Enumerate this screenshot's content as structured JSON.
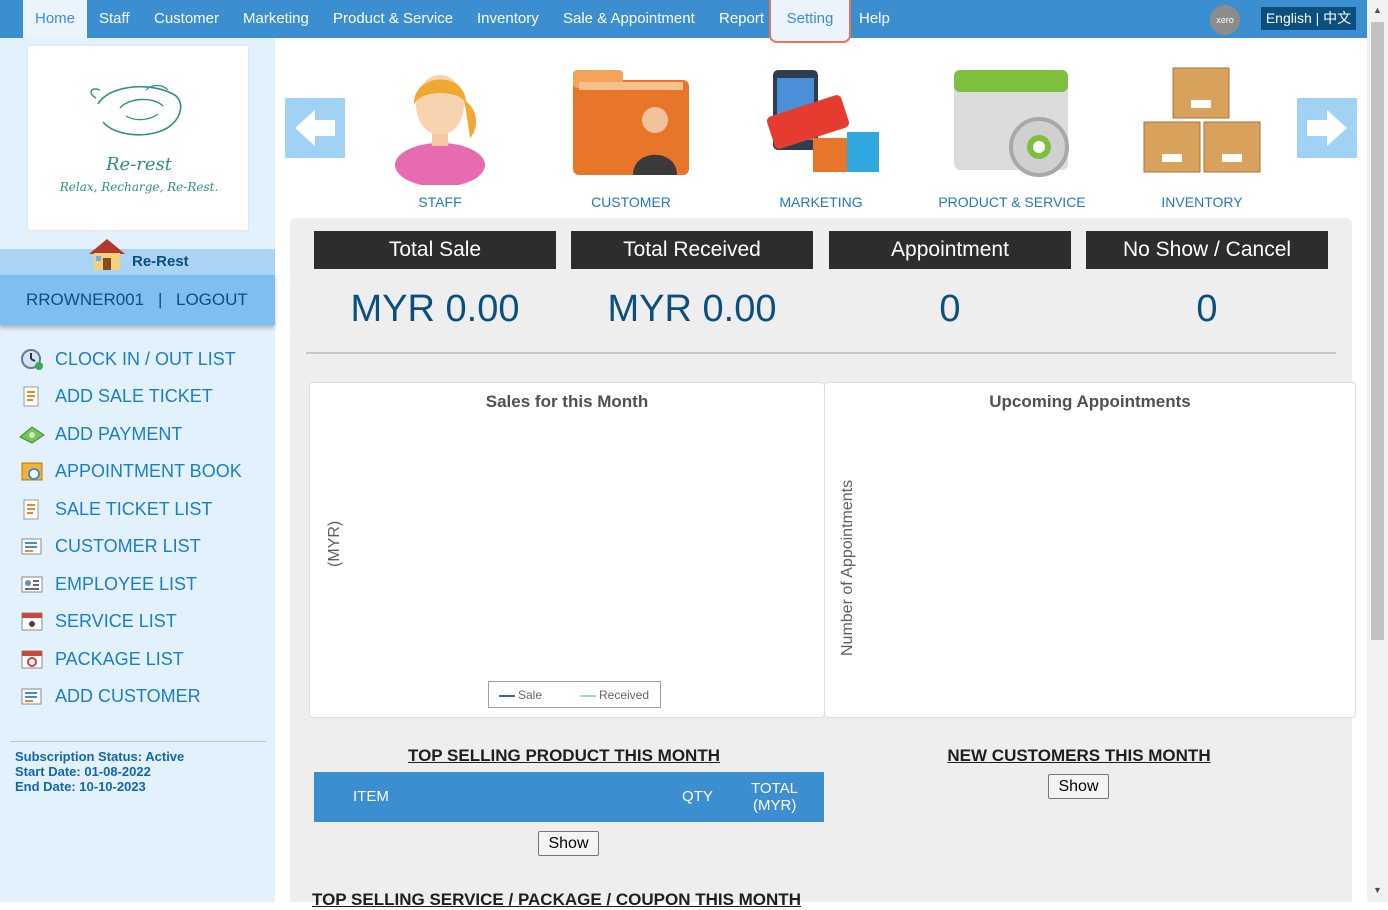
{
  "nav": {
    "items": [
      "Home",
      "Staff",
      "Customer",
      "Marketing",
      "Product & Service",
      "Inventory",
      "Sale & Appointment",
      "Report",
      "Setting",
      "Help"
    ],
    "xero": "xero",
    "language": "English | 中文"
  },
  "sidebar": {
    "logo_title": "Re-rest",
    "logo_tagline": "Relax, Recharge, Re-Rest.",
    "shop_name": "Re-Rest",
    "username": "RROWNER001",
    "separator": "|",
    "logout": "LOGOUT",
    "menu": [
      {
        "label": "CLOCK IN / OUT LIST",
        "icon": "clock-icon"
      },
      {
        "label": "ADD SALE TICKET",
        "icon": "sale-ticket-icon"
      },
      {
        "label": "ADD PAYMENT",
        "icon": "money-icon"
      },
      {
        "label": "APPOINTMENT BOOK",
        "icon": "appointment-book-icon"
      },
      {
        "label": "SALE TICKET LIST",
        "icon": "sale-ticket-list-icon"
      },
      {
        "label": "CUSTOMER LIST",
        "icon": "customer-list-icon"
      },
      {
        "label": "EMPLOYEE LIST",
        "icon": "employee-list-icon"
      },
      {
        "label": "SERVICE LIST",
        "icon": "service-list-icon"
      },
      {
        "label": "PACKAGE LIST",
        "icon": "package-list-icon"
      },
      {
        "label": "ADD CUSTOMER",
        "icon": "add-customer-icon"
      }
    ],
    "subscription_status": "Subscription Status: Active",
    "start_date": "Start Date: 01-08-2022",
    "end_date": "End Date: 10-10-2023"
  },
  "modules": [
    {
      "label": "STAFF",
      "icon": "staff-icon"
    },
    {
      "label": "CUSTOMER",
      "icon": "customer-folder-icon"
    },
    {
      "label": "MARKETING",
      "icon": "marketing-open-icon"
    },
    {
      "label": "PRODUCT & SERVICE",
      "icon": "product-gear-icon"
    },
    {
      "label": "INVENTORY",
      "icon": "inventory-boxes-icon"
    }
  ],
  "stats": [
    {
      "label": "Total Sale",
      "value": "MYR 0.00"
    },
    {
      "label": "Total Received",
      "value": "MYR 0.00"
    },
    {
      "label": "Appointment",
      "value": "0"
    },
    {
      "label": "No Show / Cancel",
      "value": "0"
    }
  ],
  "sales_chart": {
    "title": "Sales for this Month",
    "ylabel": "(MYR)",
    "legend": [
      "Sale",
      "Received"
    ],
    "colors": [
      "#2f6f8f",
      "#9fd3e8"
    ]
  },
  "appointments_chart": {
    "title": "Upcoming Appointments",
    "ylabel": "Number of Appointments"
  },
  "top_products": {
    "title": "TOP SELLING PRODUCT THIS MONTH",
    "columns": [
      "ITEM",
      "QTY",
      "TOTAL",
      "(MYR)"
    ],
    "show_label": "Show"
  },
  "new_customers": {
    "title": "NEW CUSTOMERS THIS MONTH",
    "show_label": "Show"
  },
  "top_services": {
    "title": "TOP SELLING SERVICE / PACKAGE / COUPON THIS MONTH"
  },
  "chart_data": [
    {
      "type": "line",
      "title": "Sales for this Month",
      "ylabel": "(MYR)",
      "series": [
        {
          "name": "Sale",
          "values": []
        },
        {
          "name": "Received",
          "values": []
        }
      ]
    },
    {
      "type": "bar",
      "title": "Upcoming Appointments",
      "ylabel": "Number of Appointments",
      "values": []
    }
  ]
}
